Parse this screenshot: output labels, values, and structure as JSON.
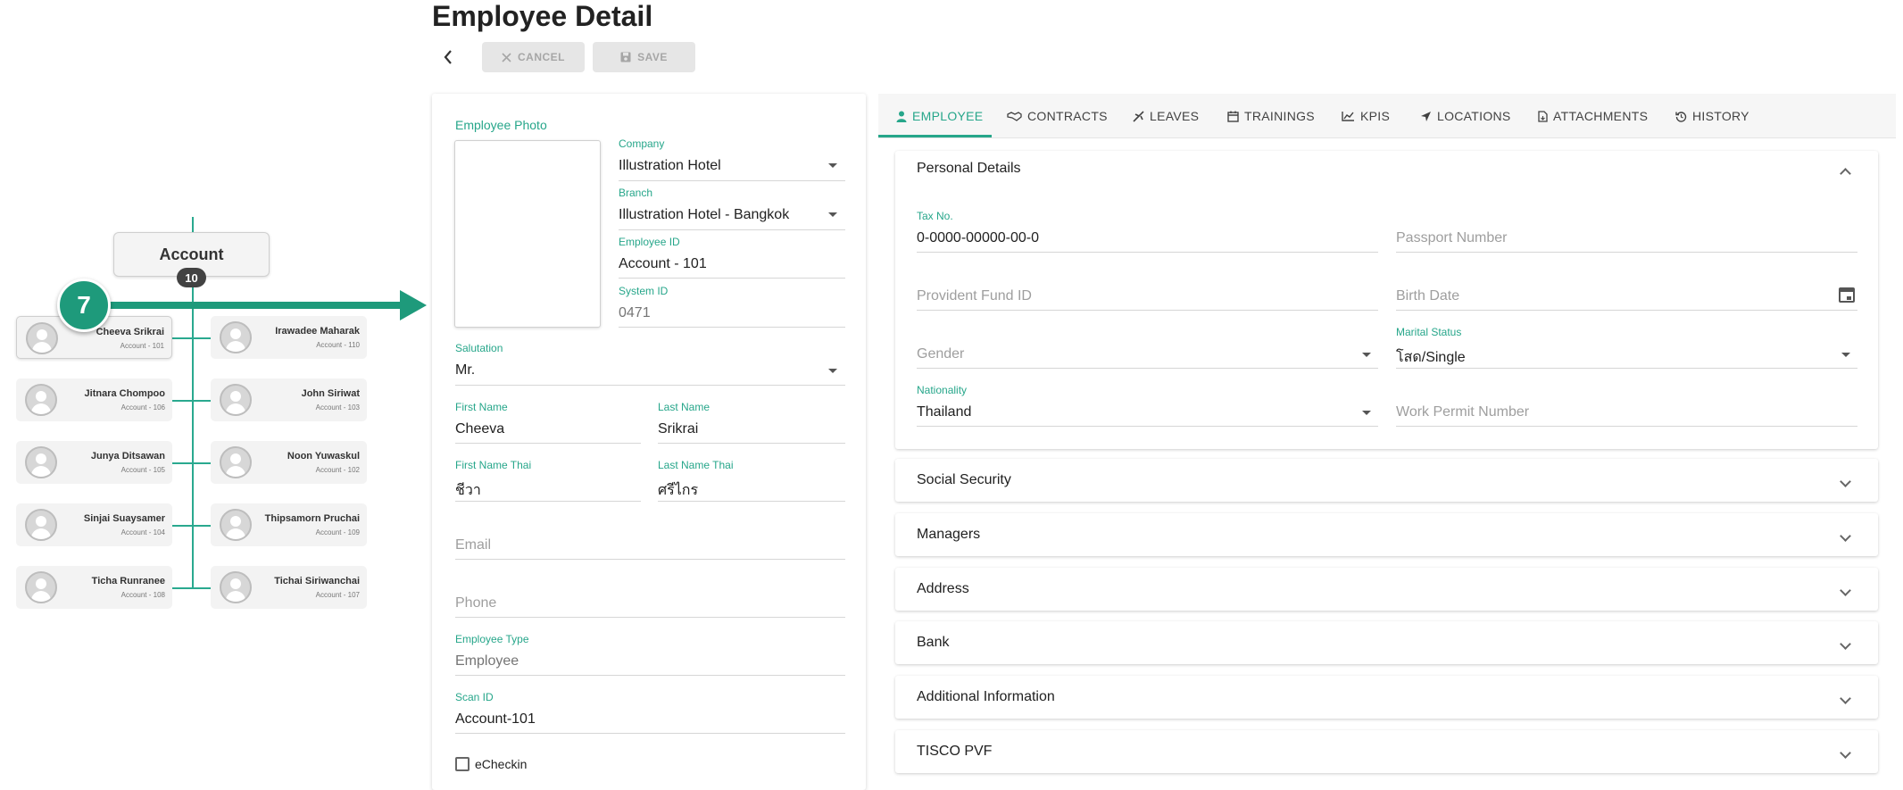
{
  "org_chart": {
    "department": {
      "name": "Account",
      "count": "10"
    },
    "step_number": "7",
    "employees_left": [
      {
        "name": "Cheeva Srikrai",
        "id": "Account - 101",
        "selected": true
      },
      {
        "name": "Jitnara Chompoo",
        "id": "Account - 106"
      },
      {
        "name": "Junya Ditsawan",
        "id": "Account - 105"
      },
      {
        "name": "Sinjai Suaysamer",
        "id": "Account - 104"
      },
      {
        "name": "Ticha Runranee",
        "id": "Account - 108"
      }
    ],
    "employees_right": [
      {
        "name": "Irawadee Maharak",
        "id": "Account - 110"
      },
      {
        "name": "John Siriwat",
        "id": "Account - 103"
      },
      {
        "name": "Noon Yuwaskul",
        "id": "Account - 102"
      },
      {
        "name": "Thipsamorn Pruchai",
        "id": "Account - 109"
      },
      {
        "name": "Tichai Siriwanchai",
        "id": "Account - 107"
      }
    ]
  },
  "header": {
    "title": "Employee Detail",
    "back_icon": "chevron-left-icon",
    "cancel_label": "CANCEL",
    "save_label": "SAVE"
  },
  "form": {
    "photo_label": "Employee Photo",
    "company": {
      "label": "Company",
      "value": "Illustration Hotel"
    },
    "branch": {
      "label": "Branch",
      "value": "Illustration Hotel - Bangkok"
    },
    "employee_id": {
      "label": "Employee ID",
      "value": "Account - 101"
    },
    "system_id": {
      "label": "System ID",
      "value": "0471"
    },
    "salutation": {
      "label": "Salutation",
      "value": "Mr."
    },
    "first_name": {
      "label": "First Name",
      "value": "Cheeva"
    },
    "last_name": {
      "label": "Last Name",
      "value": "Srikrai"
    },
    "first_name_thai": {
      "label": "First Name Thai",
      "value": "ชีวา"
    },
    "last_name_thai": {
      "label": "Last Name Thai",
      "value": "ศรีไกร"
    },
    "email": {
      "placeholder": "Email"
    },
    "phone": {
      "placeholder": "Phone"
    },
    "employee_type": {
      "label": "Employee Type",
      "value": "Employee"
    },
    "scan_id": {
      "label": "Scan ID",
      "value": "Account-101"
    },
    "echeckin": {
      "label": "eCheckin",
      "checked": false
    }
  },
  "tabs": [
    {
      "label": "EMPLOYEE",
      "icon": "person-icon",
      "active": true
    },
    {
      "label": "CONTRACTS",
      "icon": "handshake-icon"
    },
    {
      "label": "LEAVES",
      "icon": "plane-icon"
    },
    {
      "label": "TRAININGS",
      "icon": "calendar-icon"
    },
    {
      "label": "KPIS",
      "icon": "chart-line-icon"
    },
    {
      "label": "LOCATIONS",
      "icon": "location-arrow-icon"
    },
    {
      "label": "ATTACHMENTS",
      "icon": "file-icon"
    },
    {
      "label": "HISTORY",
      "icon": "history-icon"
    }
  ],
  "personal_details": {
    "title": "Personal Details",
    "tax_no": {
      "label": "Tax No.",
      "value": "0-0000-00000-00-0"
    },
    "passport": {
      "placeholder": "Passport Number"
    },
    "provident_fund": {
      "placeholder": "Provident Fund ID"
    },
    "birth_date": {
      "placeholder": "Birth Date"
    },
    "gender": {
      "placeholder": "Gender"
    },
    "marital_status": {
      "label": "Marital Status",
      "value": "โสด/Single"
    },
    "nationality": {
      "label": "Nationality",
      "value": "Thailand"
    },
    "work_permit": {
      "placeholder": "Work Permit Number"
    }
  },
  "sections": [
    "Social Security",
    "Managers",
    "Address",
    "Bank",
    "Additional Information",
    "TISCO PVF"
  ],
  "colors": {
    "accent": "#26a68a",
    "badge": "#1e9a7b"
  }
}
